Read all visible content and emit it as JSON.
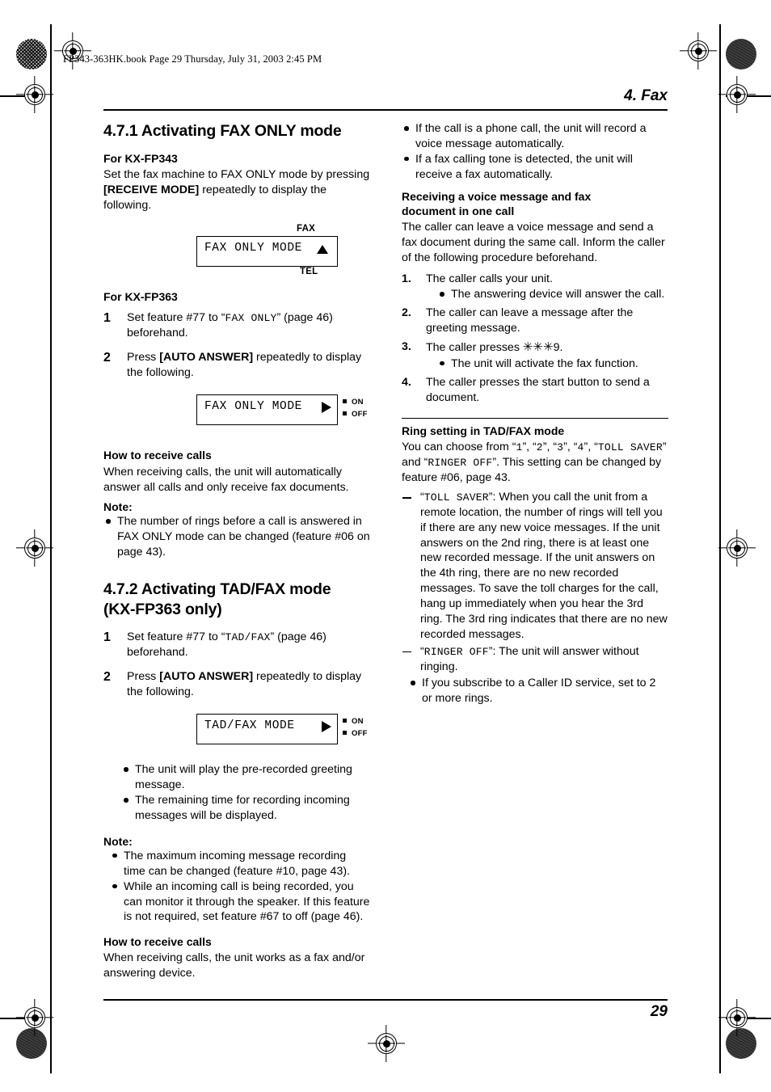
{
  "print_header": {
    "book_line": "FP343-363HK.book  Page 29  Thursday, July 31, 2003  2:45 PM"
  },
  "chapter": {
    "title": "4. Fax",
    "page_number": "29"
  },
  "left_column": {
    "section_471": {
      "heading": "4.7.1 Activating FAX ONLY mode",
      "fp343": {
        "heading": "For KX-FP343",
        "body": "Set the fax machine to FAX ONLY mode by pressing [RECEIVE MODE] repeatedly to display the following.",
        "body_part1": "Set the fax machine to FAX ONLY mode by pressing ",
        "key": "[RECEIVE MODE]",
        "body_part2": " repeatedly to display the following.",
        "display": {
          "text": "FAX ONLY MODE",
          "indicator": "triangle-up",
          "label_top": "FAX",
          "label_bottom": "TEL"
        }
      },
      "fp363": {
        "heading": "For KX-FP363",
        "steps": [
          {
            "num": "1",
            "part1": "Set feature #77 to “",
            "mono": "FAX ONLY",
            "part2": "” (page 46) beforehand."
          },
          {
            "num": "2",
            "part1": "Press ",
            "key": "[AUTO ANSWER]",
            "part2": " repeatedly to display the following."
          }
        ],
        "display": {
          "text": "FAX ONLY MODE",
          "indicator": "triangle-right",
          "on_label": "ON",
          "off_label": "OFF"
        }
      },
      "how_to_receive": {
        "heading": "How to receive calls",
        "body": "When receiving calls, the unit will automatically answer all calls and only receive fax documents."
      },
      "note": {
        "label": "Note:",
        "items": [
          "The number of rings before a call is answered in FAX ONLY mode can be changed (feature #06 on page 43)."
        ]
      }
    },
    "section_472": {
      "heading_line1": "4.7.2 Activating TAD/FAX mode",
      "heading_line2": "(KX-FP363 only)",
      "steps": [
        {
          "num": "1",
          "part1": "Set feature #77 to “",
          "mono": "TAD/FAX",
          "part2": "” (page 46) beforehand."
        },
        {
          "num": "2",
          "part1": "Press ",
          "key": "[AUTO ANSWER]",
          "part2": " repeatedly to display the following."
        }
      ],
      "display": {
        "text": "TAD/FAX MODE",
        "indicator": "triangle-right",
        "on_label": "ON",
        "off_label": "OFF"
      },
      "bullets": [
        "The unit will play the pre-recorded greeting message.",
        "The remaining time for recording incoming messages will be displayed."
      ],
      "note": {
        "label": "Note:",
        "items": [
          "The maximum incoming message recording time can be changed (feature #10, page 43).",
          "While an incoming call is being recorded, you can monitor it through the speaker. If this feature is not required, set feature #67 to off (page 46)."
        ]
      },
      "how_to_receive": {
        "heading": "How to receive calls",
        "body": "When receiving calls, the unit works as a fax and/or answering device."
      }
    }
  },
  "right_column": {
    "top_bullets": [
      "If the call is a phone call, the unit will record a voice message automatically.",
      "If a fax calling tone is detected, the unit will receive a fax automatically."
    ],
    "receiving_section": {
      "heading_line1": "Receiving a voice message and fax",
      "heading_line2": "document in one call",
      "body": "The caller can leave a voice message and send a fax document during the same call. Inform the caller of the following procedure beforehand.",
      "steps": [
        {
          "num": "1.",
          "text": "The caller calls your unit.",
          "sub": [
            "The answering device will answer the call."
          ]
        },
        {
          "num": "2.",
          "text": "The caller can leave a message after the greeting message.",
          "sub": []
        },
        {
          "num": "3.",
          "text_part1": "The caller presses ",
          "stars": "✳✳✳",
          "text_part2": "9.",
          "sub": [
            "The unit will activate the fax function."
          ]
        },
        {
          "num": "4.",
          "text": "The caller presses the start button to send a document.",
          "sub": []
        }
      ]
    },
    "ring_setting": {
      "heading": "Ring setting in TAD/FAX mode",
      "intro_p1": "You can choose from “",
      "options_mono": [
        "1",
        "2",
        "3",
        "4",
        "TOLL SAVER",
        "RINGER OFF"
      ],
      "intro_p2": "”. This setting can be changed by feature #06, page 43.",
      "dash_items": [
        {
          "mono": "TOLL SAVER",
          "text": "”: When you call the unit from a remote location, the number of rings will tell you if there are any new voice messages. If the unit answers on the 2nd ring, there is at least one new recorded message. If the unit answers on the 4th ring, there are no new recorded messages. To save the toll charges for the call, hang up immediately when you hear the 3rd ring. The 3rd ring indicates that there are no new recorded messages."
        },
        {
          "mono": "RINGER OFF",
          "text": "”: The unit will answer without ringing."
        }
      ],
      "bullets": [
        "If you subscribe to a Caller ID service, set to 2 or more rings."
      ]
    }
  }
}
